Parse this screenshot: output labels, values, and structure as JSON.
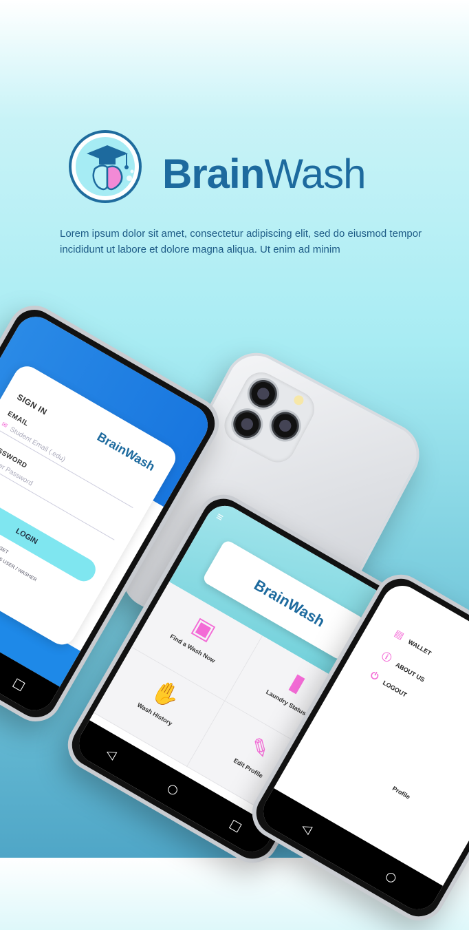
{
  "brand": {
    "bold": "Brain",
    "regular": "Wash",
    "icon": "graduation-brain-logo"
  },
  "tagline": "Lorem ipsum dolor sit amet, consectetur adipiscing elit, sed do eiusmod tempor incididunt ut labore et dolore magna aliqua. Ut enim ad minim",
  "login_screen": {
    "title": "SIGN IN",
    "email_label": "EMAIL",
    "email_placeholder": "Student Email (.edu)",
    "password_label": "PASSWORD",
    "password_placeholder": "Enter Password",
    "login_button": "LOGIN",
    "forgot": "FORGOT PASSWORD? RESET",
    "register": "NO ACCOUNT? REGISTER AS USER / WASHER",
    "logo_text": "BrainWash"
  },
  "home_screen": {
    "logo_text": "BrainWash",
    "tiles": [
      {
        "label": "Find a Wash Now",
        "icon": "washing-machine-icon"
      },
      {
        "label": "Laundry Status",
        "icon": "battery-icon"
      },
      {
        "label": "Wash History",
        "icon": "hands-bubbles-icon"
      },
      {
        "label": "Edit Profile",
        "icon": "edit-document-icon"
      }
    ]
  },
  "menu_screen": {
    "items": [
      {
        "label": "WALLET",
        "icon": "wallet-icon"
      },
      {
        "label": "ABOUT US",
        "icon": "info-icon"
      },
      {
        "label": "LOGOUT",
        "icon": "logout-icon"
      }
    ],
    "partial": "Profile"
  },
  "colors": {
    "brand": "#1d6a9e",
    "accent": "#f36bd6",
    "blue": "#1876df",
    "cyan": "#7fe6f0"
  }
}
